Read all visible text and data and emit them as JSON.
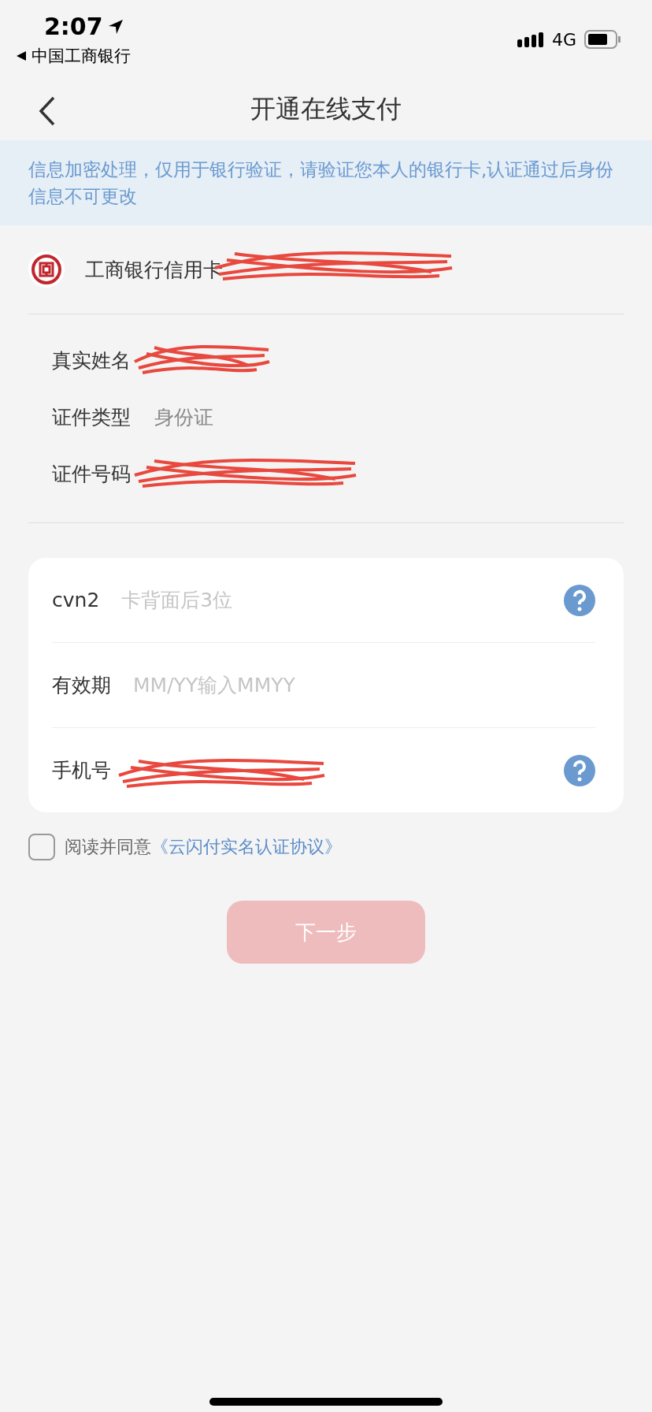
{
  "status_bar": {
    "time": "2:07",
    "back_app": "中国工商银行",
    "network": "4G"
  },
  "nav": {
    "title": "开通在线支付"
  },
  "notice": "信息加密处理，仅用于银行验证，请验证您本人的银行卡,认证通过后身份信息不可更改",
  "card": {
    "name": "工商银行信用卡"
  },
  "identity": [
    {
      "label": "真实姓名",
      "redacted": true
    },
    {
      "label": "证件类型",
      "value": "身份证",
      "redacted": false
    },
    {
      "label": "证件号码",
      "redacted": true
    }
  ],
  "form": [
    {
      "label": "cvn2",
      "placeholder": "卡背面后3位",
      "help": true,
      "redacted": false
    },
    {
      "label": "有效期",
      "placeholder": "MM/YY输入MMYY",
      "help": false,
      "redacted": false
    },
    {
      "label": "手机号",
      "help": true,
      "redacted": true
    }
  ],
  "agreement": {
    "checked": false,
    "text": "阅读并同意",
    "link": "《云闪付实名认证协议》"
  },
  "next_button": {
    "label": "下一步",
    "disabled": true
  }
}
